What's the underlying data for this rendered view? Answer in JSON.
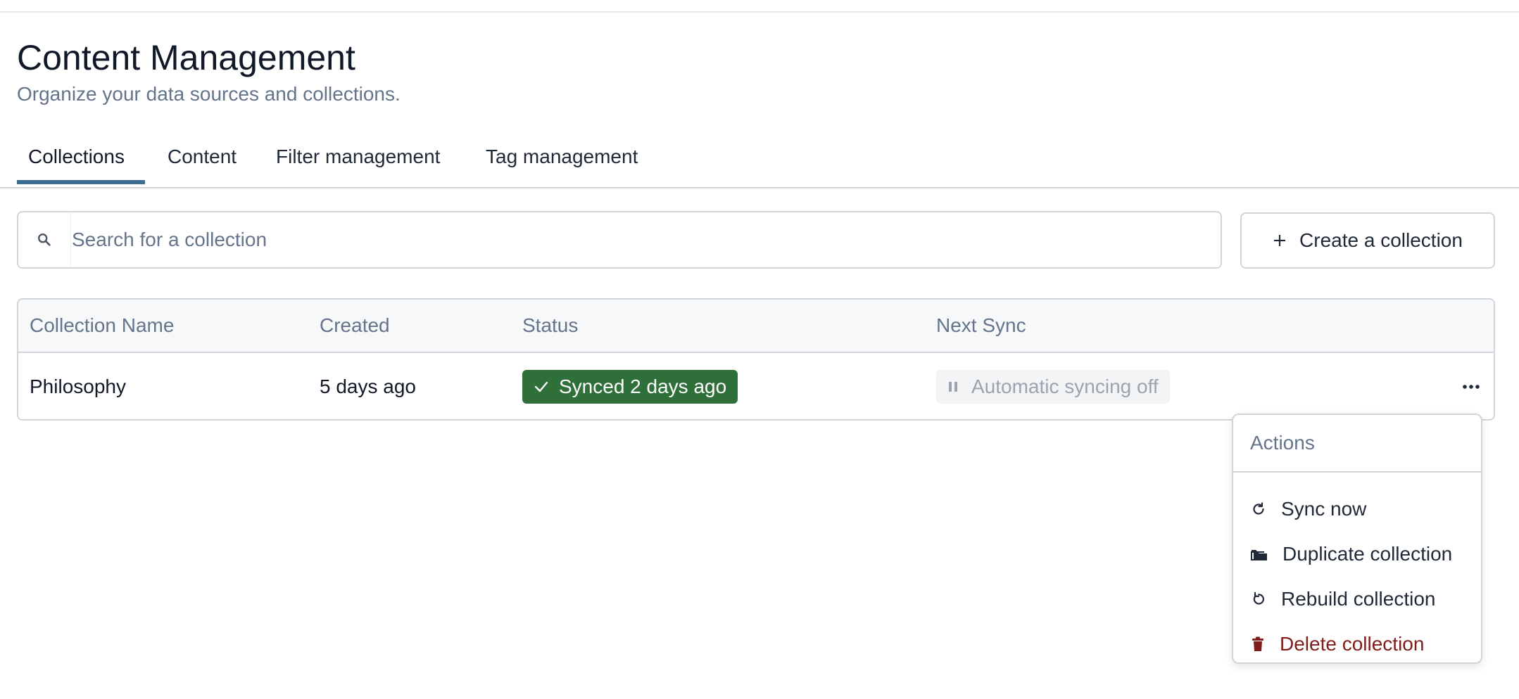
{
  "header": {
    "title": "Content Management",
    "subtitle": "Organize your data sources and collections."
  },
  "tabs": [
    {
      "label": "Collections",
      "active": true
    },
    {
      "label": "Content",
      "active": false
    },
    {
      "label": "Filter management",
      "active": false
    },
    {
      "label": "Tag management",
      "active": false
    }
  ],
  "search": {
    "placeholder": "Search for a collection",
    "value": ""
  },
  "create_button": {
    "label": "Create a collection",
    "icon": "plus-icon"
  },
  "table": {
    "columns": [
      "Collection Name",
      "Created",
      "Status",
      "Next Sync"
    ],
    "rows": [
      {
        "name": "Philosophy",
        "created": "5 days ago",
        "status": "Synced 2 days ago",
        "next_sync": "Automatic syncing off"
      }
    ]
  },
  "actions_menu": {
    "header": "Actions",
    "items": [
      {
        "label": "Sync now",
        "icon": "refresh-icon"
      },
      {
        "label": "Duplicate collection",
        "icon": "folders-icon"
      },
      {
        "label": "Rebuild collection",
        "icon": "rebuild-icon"
      },
      {
        "label": "Delete collection",
        "icon": "trash-icon"
      }
    ]
  },
  "colors": {
    "accent": "#3b6e8f",
    "success": "#2f6f3a",
    "danger": "#7f1d1d",
    "muted_text": "#64748b"
  }
}
